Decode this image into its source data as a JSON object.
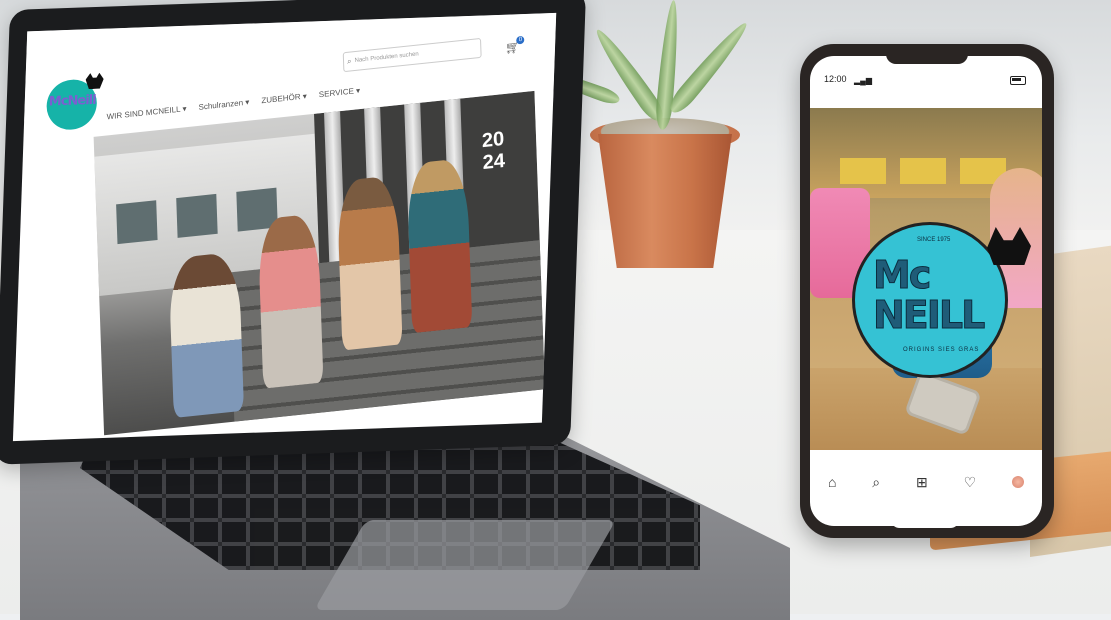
{
  "laptop_site": {
    "nav": [
      "WIR SIND MCNEILL ▾",
      "Schulranzen ▾",
      "ZUBEHÖR ▾",
      "SERVICE ▾"
    ],
    "search_placeholder": "Nach Produkten suchen",
    "cart_count": "0",
    "hero_year_top": "20",
    "hero_year_bottom": "24",
    "logo_text": "McNeill"
  },
  "phone": {
    "time": "12:00",
    "app_logo_top": "Mc",
    "app_logo_bottom": "NEILL",
    "logo_since": "SINCE 1975",
    "logo_sub": "ORIGINS SIES GRAS",
    "tabbar": [
      "home-icon",
      "search-icon",
      "add-icon",
      "heart-icon",
      "avatar"
    ]
  },
  "colors": {
    "teal": "#16b3a8",
    "logo_blue": "#35c2d4",
    "phone_frame": "#2a2523",
    "laptop_frame": "#1b1c1e"
  }
}
